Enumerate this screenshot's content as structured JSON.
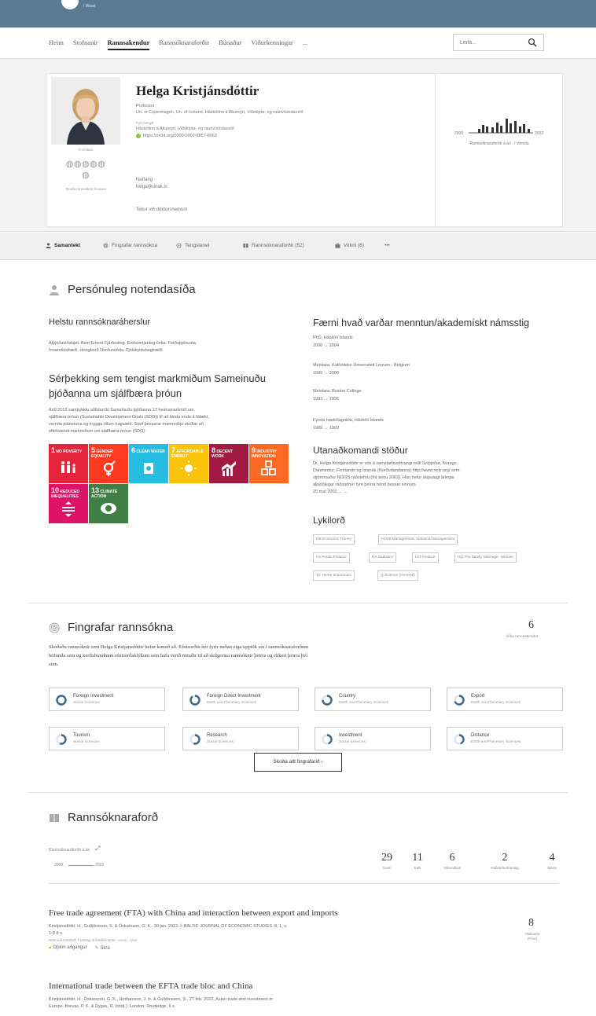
{
  "topbar": {
    "logo_text": "í Wasé"
  },
  "nav": {
    "items": [
      "Heim",
      "Stofnanir",
      "Rannsakendur",
      "Rannsóknaraforðir",
      "Búnaður",
      "Viðurkenningar",
      "..."
    ],
    "search_placeholder": "Leita..."
  },
  "profile": {
    "name": "Helga Kristjánsdóttir",
    "title": "Prófessor",
    "affiliations": "Un. of Copenhagen, Un. of Iceland, Háskólinn á Akureyri, Viðskipta- og raunvísindasvið",
    "current_label": "Fyrri tengsl",
    "current": "Háskólinn á Akureyri, Viðskipta- og raunvísindasvið",
    "orcid": "https://orcid.org/0000-0002-8857-8063",
    "hindex": "h-vísitala",
    "globe_note": "Skoða rannsóknir Scopus",
    "email_label": "Netfang",
    "email": "helga@unak.is",
    "supervise": "Tekur við doktorsnemum",
    "chart": {
      "start_year": "2000",
      "end_year": "2022",
      "caption": "Rannsóknaraforðir á ári - í vinnslu"
    }
  },
  "tabs": [
    {
      "label": "Samantekt",
      "icon": "person-icon"
    },
    {
      "label": "Fingrafar rannsókna",
      "icon": "fingerprint-icon"
    },
    {
      "label": "Tengslanet",
      "icon": "network-icon"
    },
    {
      "label": "Rannsóknaraforðir (52)",
      "icon": "book-icon"
    },
    {
      "label": "Virkni (6)",
      "icon": "briefcase-icon"
    },
    {
      "label": "•••",
      "icon": "more-icon"
    }
  ],
  "personal": {
    "title": "Persónuleg notendasíða",
    "focus_title": "Helstu rannsóknaráherslur",
    "focus_text_1": "Alþjóðaviðskipti. Bein Erlend Fjárfesting. Endurmíjanleg Orka. Ferðaþjónusta.",
    "focus_text_2": "Innanríkisfræði. Hringborð Norðurslóða. Fjölskylduhagfræði.",
    "sdg_title_1": "Sérþekking sem tengist markmiðum Sameinuðu",
    "sdg_title_2": "þjóðanna um sjálfbæra þróun",
    "sdg_text_1": "Árið 2015 samþykktu aðildarríki Sameinuðu þjóðanna 17 heimsmarkmið um",
    "sdg_text_2": "sjálfbæra þróun (Sustainable Development Goals (SDG)) til að binda enda á fátækt,",
    "sdg_text_3": "vernda plánetuna og tryggja öllum hagsæld. Starf þessarar manneskju stuðlar að",
    "sdg_text_4": "eftirfarandi markmiðum um sjálfbæra þróun (SDG):",
    "sdgs": [
      {
        "num": "1",
        "label": "NO POVERTY",
        "color": "#e5243b",
        "icon": "family-icon"
      },
      {
        "num": "5",
        "label": "GENDER EQUALITY",
        "color": "#ff3a21",
        "icon": "gender-icon"
      },
      {
        "num": "6",
        "label": "CLEAN WATER",
        "color": "#26bde2",
        "icon": "water-icon"
      },
      {
        "num": "7",
        "label": "AFFORDABLE ENERGY",
        "color": "#fcc30b",
        "icon": "sun-icon"
      },
      {
        "num": "8",
        "label": "DECENT WORK",
        "color": "#a21942",
        "icon": "growth-chart-icon"
      },
      {
        "num": "9",
        "label": "INDUSTRY INNOVATION",
        "color": "#fd6925",
        "icon": "cubes-icon"
      },
      {
        "num": "10",
        "label": "REDUCED INEQUALITIES",
        "color": "#dd1367",
        "icon": "equality-icon"
      },
      {
        "num": "13",
        "label": "CLIMATE ACTION",
        "color": "#3f7e44",
        "icon": "eye-globe-icon"
      }
    ],
    "edu_title": "Færni hvað varðar menntun/akademískt námsstig",
    "education": [
      {
        "degree": "PhD, Háskóli Íslands",
        "years": "2000 → 2004"
      },
      {
        "degree": "Meistara, Katholieke Universiteit Leuven - Belgium",
        "years": "1999 → 2000"
      },
      {
        "degree": "Meistara, Boston College",
        "years": "1993 → 1995"
      },
      {
        "degree": "Fyrsta háskólagráða, Háskóli Íslands",
        "years": "1989 → 1992"
      }
    ],
    "ext_title": "Utanaðkomandi stöður",
    "ext_text_1": "Dr. Helga Kristjánsdóttir er virk á samstarfsvettvangi milli Svíþjóðar, Noregs,",
    "ext_text_2": "Danmerkur, Finnlands og Íslands (Norðurlandanna) http://www.nols.org/ sem",
    "ext_text_3": "stjórnmaður NOITS ráðstefnu (frá árinu 2002). Hún hefur skipulagt árlegar",
    "ext_text_4": "alþjóðlegar ráðstefnur fyrir þeirra hönd þessar sinnum.",
    "ext_date": "20 maí 2002 → ...",
    "kw_title": "Lykilorð",
    "keywords": [
      "HB Economic Theory",
      "HD28 Management. Industrial Management",
      "HJ Public Finance",
      "HA Statistics",
      "HG Finance",
      "HQ The family. Marriage. Woman",
      "TX Home economics",
      "Q Science (General)"
    ]
  },
  "fingerprint": {
    "title": "Fingrafar rannsókna",
    "count": "6",
    "count_label": "Álíka rannsakendur",
    "desc_1": "Skoðaðu rannsóknir sem Helga Kristjánsdóttir hefur komið að. Efnisorðin hér fyrir neðan eiga upptök sín í rannsóknaraforðum",
    "desc_2": "höfunda sem og kerfisbundnum efnisorðaklýkum sem hafa verið notaðir til að skilgreina rannsóknir þeirra og ekkert þeirra því",
    "desc_3": "sinn.",
    "items": [
      {
        "name": "Foreign Investment",
        "sub": "Social Sciences",
        "pct": 1.0
      },
      {
        "name": "Foreign Direct Investment",
        "sub": "Earth and Planetary Sciences",
        "pct": 0.9
      },
      {
        "name": "Country",
        "sub": "Earth and Planetary Sciences",
        "pct": 0.75
      },
      {
        "name": "Export",
        "sub": "Earth and Planetary Sciences",
        "pct": 0.7
      },
      {
        "name": "Tourism",
        "sub": "Social Sciences",
        "pct": 0.55
      },
      {
        "name": "Research",
        "sub": "Social Sciences",
        "pct": 0.55
      },
      {
        "name": "Investment",
        "sub": "Social Sciences",
        "pct": 0.45
      },
      {
        "name": "Distance",
        "sub": "Earth and Planetary Sciences",
        "pct": 0.45
      }
    ],
    "button": "Skoða allt fingrafarið ›"
  },
  "outputs": {
    "title": "Rannsóknaraforð",
    "per_year_label": "Rannsóknaraforðir á ári",
    "year_start": "2000",
    "year_end": "2022",
    "stats": [
      {
        "n": "29",
        "l": "Grein"
      },
      {
        "n": "11",
        "l": "Kafli"
      },
      {
        "n": "6",
        "l": "Viðmaðkjal"
      },
      {
        "n": "2",
        "l": "Ráðstefnuframlag"
      },
      {
        "n": "4",
        "l": "Meira"
      }
    ],
    "pubs": [
      {
        "title": "Free trade agreement (FTA) with China and interaction between export and imports",
        "meta1": "Kristjánsdóttir, H., Guðjónsson, S. & Óskarsson, G. K., 30 jan. 2022, Í: BALTIC JOURNAL OF ECONOMIC STUDIES. 8, 1, s.",
        "meta2": "1-8 8 s.",
        "meta3": "Rannsóknaraforð: Framlag til fræðitímarits › Grein › rýnd",
        "open_access": "Opinn aðgangur",
        "file": "Skrá",
        "cit_n": "8",
        "cit_l": "Tilvitnanir (Pure)"
      },
      {
        "title": "International trade between the EFTA trade bloc and China",
        "meta1": "Kristjánsdóttir, H., Óskarsson, G. K., Heiðarsson, J. Þ. & Guðjónsson, S., 27 feb. 2022, Asian trade and investment in",
        "meta2": "Europe. Brevas, P. K. & Dygas, R. (ritstj.). London: Routledge, 6 s."
      }
    ]
  }
}
